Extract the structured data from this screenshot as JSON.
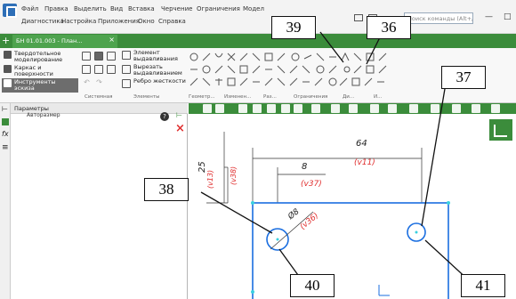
{
  "menu": {
    "items": [
      "Файл",
      "Правка",
      "Выделить",
      "Вид",
      "Вставка",
      "Черчение",
      "Ограничения",
      "Модел"
    ],
    "items_row2": [
      "Диагностика",
      "Настройка",
      "Приложения",
      "Окно",
      "Справка"
    ],
    "search_placeholder": "Поиск команды (Alt+/)",
    "minimize": "—",
    "close": "□"
  },
  "tabs": {
    "document_tab": "БН 01.01.003 - План...",
    "add": "+",
    "close": "×"
  },
  "ribbon": {
    "modes": [
      "Твердотельное моделирование",
      "Каркас и поверхности",
      "Инструменты эскиза"
    ],
    "mode_labels": {
      "solid": "Твердотельное\nмоделирование",
      "wire": "Каркас и\nповерхности",
      "sketch": "Инструменты\nэскиза"
    },
    "operations": [
      "Элемент выдавливания",
      "Вырезать выдавливанием",
      "Ребро жесткости"
    ],
    "op_labels": {
      "extrude": "Элемент\nвыдавливания",
      "cut": "Вырезать\nвыдавливанием",
      "rib": "Ребро\nжесткости"
    },
    "sections": [
      "Системная",
      "Элементы",
      "Геометр...",
      "Изменен...",
      "Раз...",
      "Ограничения",
      "Ди...",
      "И..."
    ]
  },
  "panel": {
    "title": "Параметры",
    "autodim": "Авторазмер",
    "help_icon": "?",
    "close_icon": "×"
  },
  "left_strip_icons": [
    "tree-icon",
    "layers-icon",
    "function-icon",
    "list-icon"
  ],
  "drawing": {
    "dimensions": {
      "d64": "64",
      "v11": "(v11)",
      "d8": "8",
      "v37": "(v37)",
      "d25": "25",
      "v13": "(v13)",
      "v38": "(v38)",
      "d8dia": "Ø8",
      "v36": "(v36)"
    },
    "accent_color": "#e03030",
    "geometry_color": "#1a6ee0"
  },
  "callouts": {
    "c36": "36",
    "c37": "37",
    "c38": "38",
    "c39": "39",
    "c40": "40",
    "c41": "41"
  }
}
